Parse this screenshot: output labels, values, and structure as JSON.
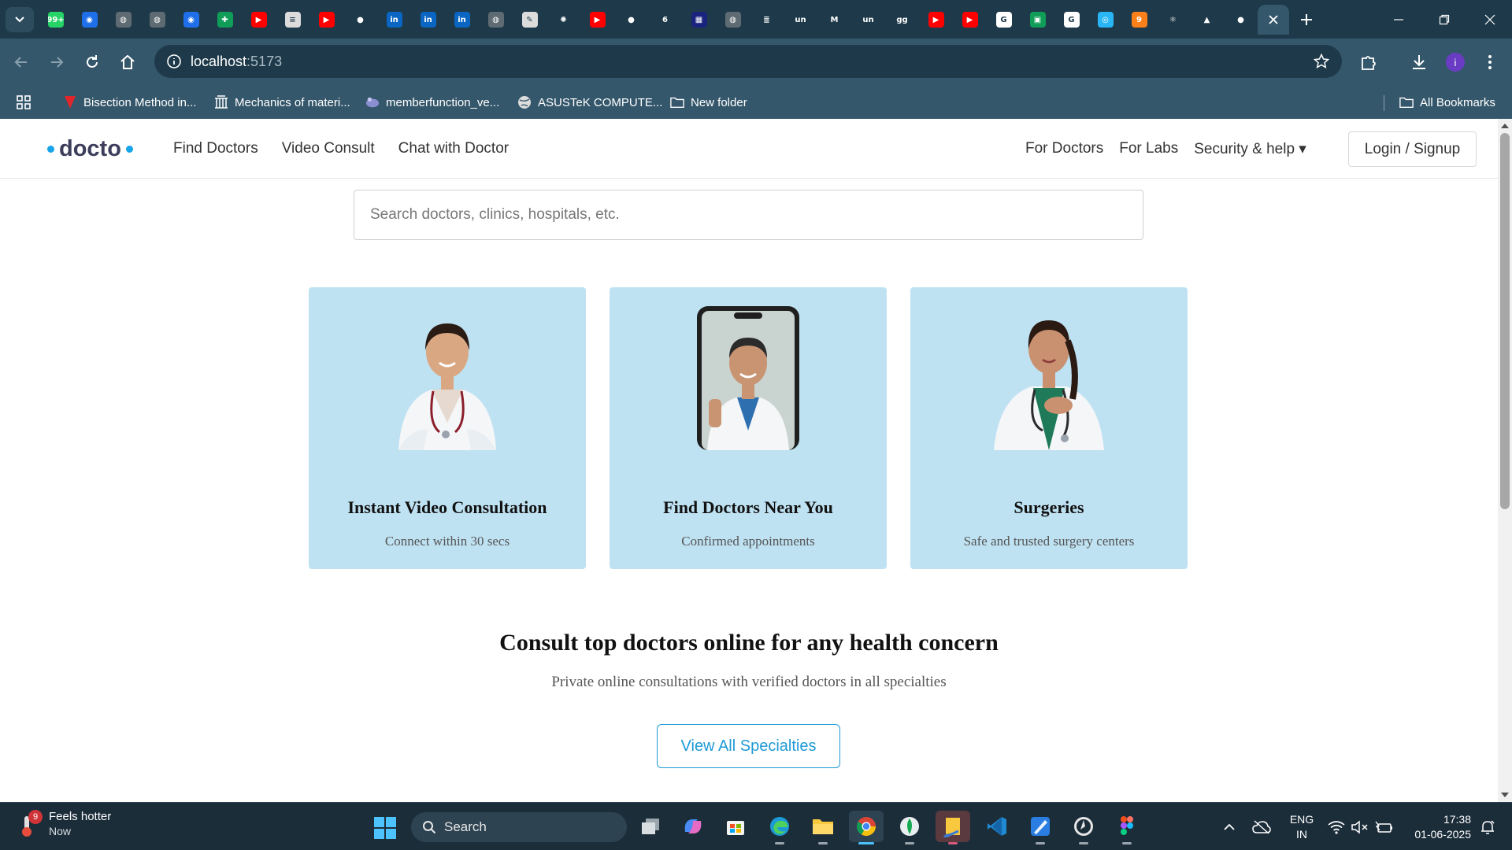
{
  "browser": {
    "url_host": "localhost",
    "url_port": ":5173",
    "tabs": [
      {
        "icon": "whatsapp-icon",
        "color": "#25d366",
        "glyph": "99+"
      },
      {
        "icon": "github-copilot-icon",
        "color": "#1f6feb",
        "glyph": "◉"
      },
      {
        "icon": "globe-icon",
        "color": "#5f6b73",
        "glyph": "◍"
      },
      {
        "icon": "globe-icon",
        "color": "#5f6b73",
        "glyph": "◍"
      },
      {
        "icon": "github-copilot-icon",
        "color": "#1f6feb",
        "glyph": "◉"
      },
      {
        "icon": "google-sheets-icon",
        "color": "#0f9d58",
        "glyph": "✚"
      },
      {
        "icon": "youtube-icon",
        "color": "#ff0000",
        "glyph": "▶"
      },
      {
        "icon": "doc-icon",
        "color": "#dcdcdc",
        "glyph": "≡"
      },
      {
        "icon": "youtube-icon",
        "color": "#ff0000",
        "glyph": "▶"
      },
      {
        "icon": "github-icon",
        "color": "#1e3a4a",
        "glyph": "●"
      },
      {
        "icon": "linkedin-icon",
        "color": "#0a66c2",
        "glyph": "in"
      },
      {
        "icon": "linkedin-icon",
        "color": "#0a66c2",
        "glyph": "in"
      },
      {
        "icon": "linkedin-icon",
        "color": "#0a66c2",
        "glyph": "in"
      },
      {
        "icon": "globe-icon",
        "color": "#5f6b73",
        "glyph": "◍"
      },
      {
        "icon": "pen-icon",
        "color": "#dcdcdc",
        "glyph": "✎"
      },
      {
        "icon": "openai-icon",
        "color": "#1e3a4a",
        "glyph": "✺"
      },
      {
        "icon": "youtube-icon",
        "color": "#ff0000",
        "glyph": "▶"
      },
      {
        "icon": "github-icon",
        "color": "#1e3a4a",
        "glyph": "●"
      },
      {
        "icon": "leetcode-icon",
        "color": "#1e3a4a",
        "glyph": "6"
      },
      {
        "icon": "calendar-icon",
        "color": "#1a237e",
        "glyph": "▦"
      },
      {
        "icon": "globe-icon",
        "color": "#5f6b73",
        "glyph": "◍"
      },
      {
        "icon": "stack-icon",
        "color": "#1e3a4a",
        "glyph": "≣"
      },
      {
        "icon": "unstop-icon",
        "color": "#1e3a4a",
        "glyph": "un"
      },
      {
        "icon": "gmail-icon",
        "color": "#1e3a4a",
        "glyph": "M"
      },
      {
        "icon": "unstop-icon",
        "color": "#1e3a4a",
        "glyph": "un"
      },
      {
        "icon": "geeksforgeeks-icon",
        "color": "#1e3a4a",
        "glyph": "gg"
      },
      {
        "icon": "youtube-icon",
        "color": "#ff0000",
        "glyph": "▶"
      },
      {
        "icon": "youtube-icon",
        "color": "#ff0000",
        "glyph": "▶"
      },
      {
        "icon": "google-icon",
        "color": "#ffffff",
        "glyph": "G"
      },
      {
        "icon": "sheets-icon",
        "color": "#0f9d58",
        "glyph": "▣"
      },
      {
        "icon": "google-icon",
        "color": "#ffffff",
        "glyph": "G"
      },
      {
        "icon": "search-app-icon",
        "color": "#29b6f6",
        "glyph": "◎"
      },
      {
        "icon": "swiggy-icon",
        "color": "#fc8019",
        "glyph": "9"
      },
      {
        "icon": "react-icon",
        "color": "#1e3a4a",
        "glyph": "⚛"
      },
      {
        "icon": "google-drive-icon",
        "color": "#1e3a4a",
        "glyph": "▲"
      },
      {
        "icon": "github-icon",
        "color": "#1e3a4a",
        "glyph": "●"
      }
    ],
    "bookmarks": [
      {
        "label": "Bisection Method in...",
        "icon": "bookmark-red-icon"
      },
      {
        "label": "Mechanics of materi...",
        "icon": "bookmark-building-icon"
      },
      {
        "label": "memberfunction_ve...",
        "icon": "bookmark-cpp-icon"
      },
      {
        "label": "ASUSTeK COMPUTE...",
        "icon": "globe-icon"
      },
      {
        "label": "New folder",
        "icon": "folder-icon"
      }
    ],
    "all_bookmarks": "All Bookmarks",
    "profile_initial": "i"
  },
  "site": {
    "logo": "docto",
    "nav_left": [
      "Find Doctors",
      "Video Consult",
      "Chat with Doctor"
    ],
    "nav_right": [
      "For Doctors",
      "For Labs",
      "Security & help ▾"
    ],
    "login": "Login / Signup",
    "search_placeholder": "Search doctors, clinics, hospitals, etc.",
    "cards": [
      {
        "title": "Instant Video Consultation",
        "subtitle": "Connect within 30 secs"
      },
      {
        "title": "Find Doctors Near You",
        "subtitle": "Confirmed appointments"
      },
      {
        "title": "Surgeries",
        "subtitle": "Safe and trusted surgery centers"
      }
    ],
    "section_title": "Consult top doctors online for any health concern",
    "section_subtitle": "Private online consultations with verified doctors in all specialties",
    "specialties_button": "View All Specialties",
    "accent_color": "#1e9ad6",
    "card_color": "#bfe2f3"
  },
  "taskbar": {
    "weather_badge": "9",
    "weather_title": "Feels hotter",
    "weather_sub": "Now",
    "search_label": "Search",
    "lang_line1": "ENG",
    "lang_line2": "IN",
    "time": "17:38",
    "date": "01-06-2025"
  }
}
